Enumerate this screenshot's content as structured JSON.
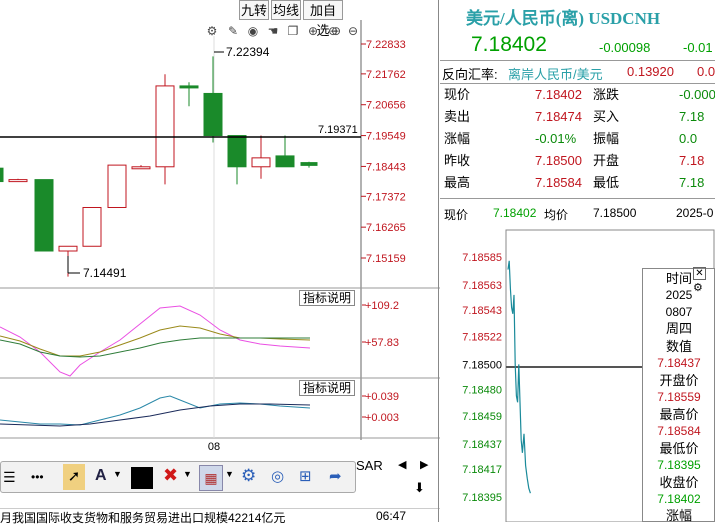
{
  "top_tabs": [
    "九转",
    "均线",
    "加自选"
  ],
  "chart_toolbar_icons": [
    "gear-icon",
    "edit-icon",
    "eye-icon",
    "hand-icon",
    "clone-icon",
    "add-icon",
    "remove-icon"
  ],
  "price_axis": [
    "7.22833",
    "7.21762",
    "7.20656",
    "7.19549",
    "7.18443",
    "7.17372",
    "7.16265",
    "7.15159"
  ],
  "candles": [
    {
      "o": 7.1838,
      "h": 7.1838,
      "l": 7.179,
      "c": 7.179
    },
    {
      "o": 7.1797,
      "h": 7.18,
      "l": 7.179,
      "c": 7.1797
    },
    {
      "o": 7.1797,
      "h": 7.1797,
      "l": 7.1541,
      "c": 7.1541
    },
    {
      "o": 7.1541,
      "h": 7.1558,
      "l": 7.1449,
      "c": 7.1558
    },
    {
      "o": 7.1558,
      "h": 7.1697,
      "l": 7.1558,
      "c": 7.1697
    },
    {
      "o": 7.1697,
      "h": 7.1849,
      "l": 7.1697,
      "c": 7.1849
    },
    {
      "o": 7.1843,
      "h": 7.1849,
      "l": 7.1838,
      "c": 7.1843
    },
    {
      "o": 7.1843,
      "h": 7.2175,
      "l": 7.178,
      "c": 7.2133
    },
    {
      "o": 7.2133,
      "h": 7.2146,
      "l": 7.206,
      "c": 7.2127
    },
    {
      "o": 7.2106,
      "h": 7.2239,
      "l": 7.193,
      "c": 7.1955
    },
    {
      "o": 7.1955,
      "h": 7.1955,
      "l": 7.178,
      "c": 7.1843
    },
    {
      "o": 7.1843,
      "h": 7.1955,
      "l": 7.18,
      "c": 7.1875
    },
    {
      "o": 7.1882,
      "h": 7.1955,
      "l": 7.1843,
      "c": 7.1843
    },
    {
      "o": 7.1858,
      "h": 7.1861,
      "l": 7.184,
      "c": 7.1848
    }
  ],
  "annotations": {
    "high_label": "7.22394",
    "low_label": "7.14491",
    "last_price_label": "7.19371"
  },
  "indicator1": {
    "button": "指标说明",
    "upper": "+109.2",
    "lower": "+57.83"
  },
  "indicator2": {
    "button": "指标说明",
    "upper": "+0.039",
    "lower": "+0.003"
  },
  "x_label": "08",
  "bottom_toolbar": {
    "more": "•••",
    "sar": "SAR"
  },
  "news": {
    "text": "月我国国际收支货物和服务贸易进出口规模42214亿元",
    "time": "06:47"
  },
  "quote": {
    "title": "美元/人民币(离) USDCNH",
    "price": "7.18402",
    "change": "-0.00098",
    "change_pct": "-0.01",
    "reverse_label": "反向汇率:",
    "reverse_pair": "离岸人民币/美元",
    "reverse_value": "0.13920",
    "reverse_extra": "0.0",
    "rows": [
      {
        "l1": "现价",
        "v1": "7.18402",
        "l2": "涨跌",
        "v2": "-0.000"
      },
      {
        "l1": "卖出",
        "v1": "7.18474",
        "l2": "买入",
        "v2": "7.18"
      },
      {
        "l1": "涨幅",
        "v1": "-0.01%",
        "l2": "振幅",
        "v2": "0.0"
      },
      {
        "l1": "昨收",
        "v1": "7.18500",
        "l2": "开盘",
        "v2": "7.18"
      },
      {
        "l1": "最高",
        "v1": "7.18584",
        "l2": "最低",
        "v2": "7.18"
      }
    ]
  },
  "intraday": {
    "header": {
      "now_label": "现价",
      "now_value": "7.18402",
      "avg_label": "均价",
      "avg_value": "7.18500",
      "date": "2025-0"
    },
    "axis": [
      "7.18585",
      "7.18563",
      "7.18543",
      "7.18522",
      "7.18500",
      "7.18480",
      "7.18459",
      "7.18437",
      "7.18417",
      "7.18395"
    ],
    "series": [
      7.18575,
      7.18582,
      7.1856,
      7.18545,
      7.1854,
      7.18555,
      7.185,
      7.18475,
      7.1847,
      7.185,
      7.1847,
      7.1844,
      7.1843,
      7.18445,
      7.1842,
      7.1841,
      7.18402,
      7.18398
    ]
  },
  "tooltip": {
    "time_label": "时间",
    "year": "2025",
    "mmdd": "0807",
    "weekday": "周四",
    "value_label": "数值",
    "value": "7.18437",
    "open_label": "开盘价",
    "open": "7.18559",
    "high_label": "最高价",
    "high": "7.18584",
    "low_label": "最低价",
    "low": "7.18395",
    "close_label": "收盘价",
    "close": "7.18402",
    "chg_label": "涨幅"
  }
}
